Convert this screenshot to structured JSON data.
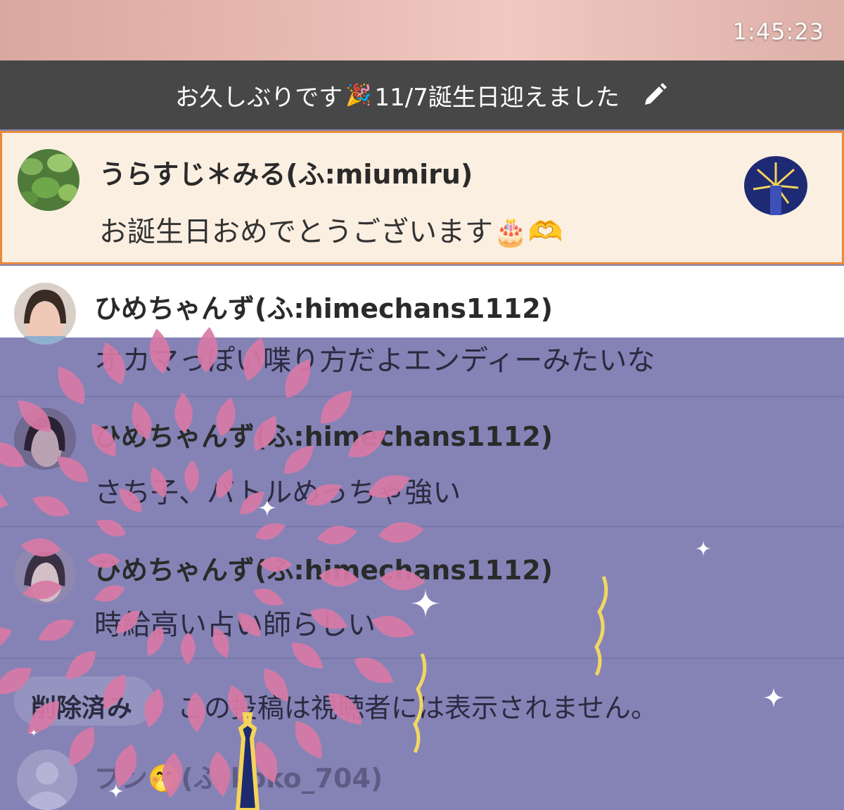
{
  "status": {
    "clock": "1:45:23"
  },
  "broadcast": {
    "title_text": "お久しぶりです",
    "title_emoji": "🎉",
    "title_rest": " 11/7誕生日迎えました"
  },
  "comments": [
    {
      "name": "うらすじ＊みる(ふ:miumiru)",
      "message": "お誕生日おめでとうございます🎂🫶"
    },
    {
      "name": "ひめちゃんず(ふ:himechans1112)",
      "message": "オカマっぽい喋り方だよエンディーみたいな"
    },
    {
      "name": "ひめちゃんず(ふ:himechans1112)",
      "message": "さち子、バトルめっちゃ強い"
    },
    {
      "name": "ひめちゃんず(ふ:himechans1112)",
      "message": "時給高い占い師らしい"
    },
    {
      "name": "削除済み",
      "message": "この投稿は視聴者には表示されません。"
    },
    {
      "name": "プン🤭(ふ:koko_704)",
      "message": ""
    }
  ],
  "colors": {
    "highlight_border": "#e9893b",
    "highlight_bg": "#fbefe2",
    "overlay_purple": "#8583b6",
    "firework_pink": "#d97aa6"
  }
}
